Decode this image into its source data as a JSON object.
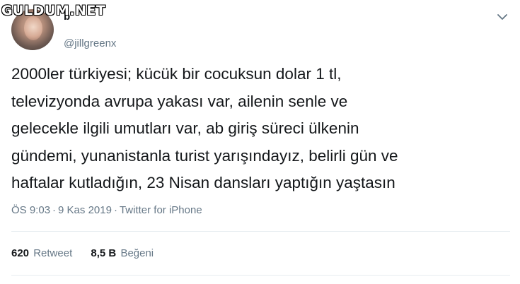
{
  "watermark": "GULDUM.NET",
  "tweet": {
    "display_name": "b",
    "handle": "@jillgreenx",
    "lines": [
      "2000ler türkiyesi; kücük bir cocuksun dolar 1 tl,",
      "televizyonda avrupa yakası var, ailenin senle ve",
      "gelecekle ilgili umutları var, ab giriş süreci ülkenin",
      "gündemi, yunanistanla turist yarışındayız, belirli gün ve",
      "haftalar kutladığın, 23 Nisan dansları yaptığın yaştasın"
    ],
    "time": "ÖS 9:03",
    "date": "9 Kas 2019",
    "separator": "·",
    "source": "Twitter for iPhone"
  },
  "stats": {
    "retweet_count": "620",
    "retweet_label": "Retweet",
    "like_count": "8,5 B",
    "like_label": "Beğeni"
  },
  "icons": {
    "menu": "chevron-down-icon"
  },
  "colors": {
    "text": "#14171a",
    "muted": "#657786",
    "divider": "#e6ecf0"
  }
}
